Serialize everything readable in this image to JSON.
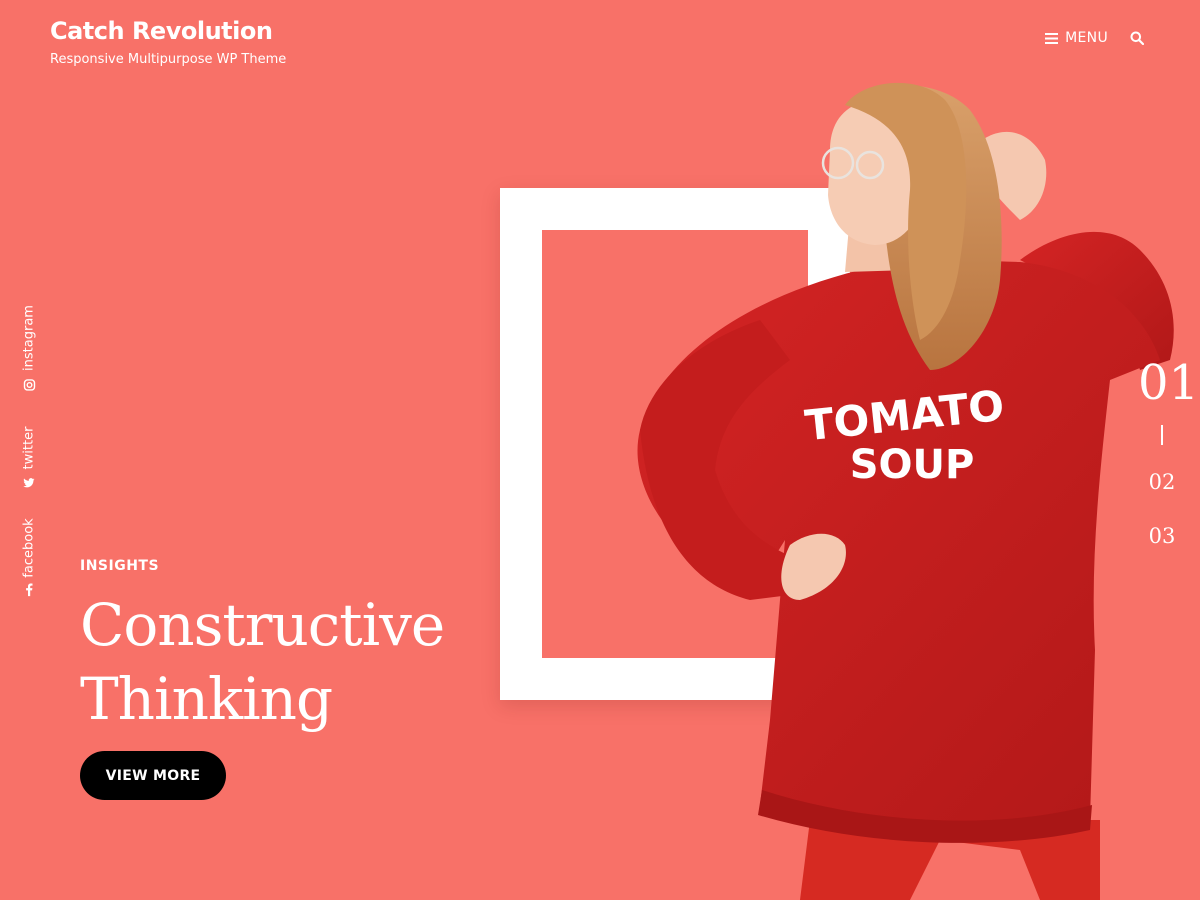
{
  "site": {
    "title": "Catch Revolution",
    "description": "Responsive Multipurpose WP Theme"
  },
  "header": {
    "menu_label": "MENU"
  },
  "social": [
    {
      "label": "instagram",
      "icon": "instagram-icon"
    },
    {
      "label": "twitter",
      "icon": "twitter-icon"
    },
    {
      "label": "facebook",
      "icon": "facebook-icon"
    }
  ],
  "slide": {
    "category": "INSIGHTS",
    "title_line1": "Constructive",
    "title_line2": "Thinking",
    "button_label": "VIEW MORE",
    "shirt_line1": "TOMATO",
    "shirt_line2": "SOUP"
  },
  "pager": {
    "active": "01",
    "items": [
      "02",
      "03"
    ]
  },
  "colors": {
    "background": "#f87168",
    "text": "#ffffff",
    "button": "#000000",
    "sweater": "#c81e1e"
  }
}
